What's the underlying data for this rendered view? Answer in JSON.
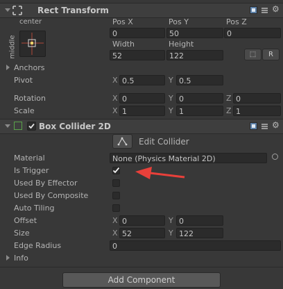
{
  "rect_transform": {
    "title": "Rect Transform",
    "anchor_h_label": "center",
    "anchor_v_label": "middle",
    "headers": [
      "Pos X",
      "Pos Y",
      "Pos Z"
    ],
    "values": [
      "0",
      "50",
      "0"
    ],
    "size_headers": [
      "Width",
      "Height"
    ],
    "size_values": [
      "52",
      "122"
    ],
    "blueprint_btn": "⬚",
    "raw_btn": "R",
    "anchors_label": "Anchors",
    "pivot": {
      "label": "Pivot",
      "x_axis": "X",
      "x": "0.5",
      "y_axis": "Y",
      "y": "0.5"
    },
    "rotation": {
      "label": "Rotation",
      "x_axis": "X",
      "x": "0",
      "y_axis": "Y",
      "y": "0",
      "z_axis": "Z",
      "z": "0"
    },
    "scale": {
      "label": "Scale",
      "x_axis": "X",
      "x": "1",
      "y_axis": "Y",
      "y": "1",
      "z_axis": "Z",
      "z": "1"
    }
  },
  "box_collider": {
    "title": "Box Collider 2D",
    "edit_collider_label": "Edit Collider",
    "material": {
      "label": "Material",
      "value": "None (Physics Material 2D)"
    },
    "is_trigger": {
      "label": "Is Trigger",
      "checked": true
    },
    "used_by_effector": {
      "label": "Used By Effector",
      "checked": false
    },
    "used_by_composite": {
      "label": "Used By Composite",
      "checked": false
    },
    "auto_tiling": {
      "label": "Auto Tiling",
      "checked": false
    },
    "offset": {
      "label": "Offset",
      "x_axis": "X",
      "x": "0",
      "y_axis": "Y",
      "y": "0"
    },
    "size": {
      "label": "Size",
      "x_axis": "X",
      "x": "52",
      "y_axis": "Y",
      "y": "122"
    },
    "edge_radius": {
      "label": "Edge Radius",
      "value": "0"
    },
    "info_label": "Info"
  },
  "add_component_label": "Add Component",
  "colors": {
    "background": "#383838",
    "field": "#2b2b2b",
    "arrow": "#e8403a",
    "checkbox_enabled": "#5aa34a"
  }
}
